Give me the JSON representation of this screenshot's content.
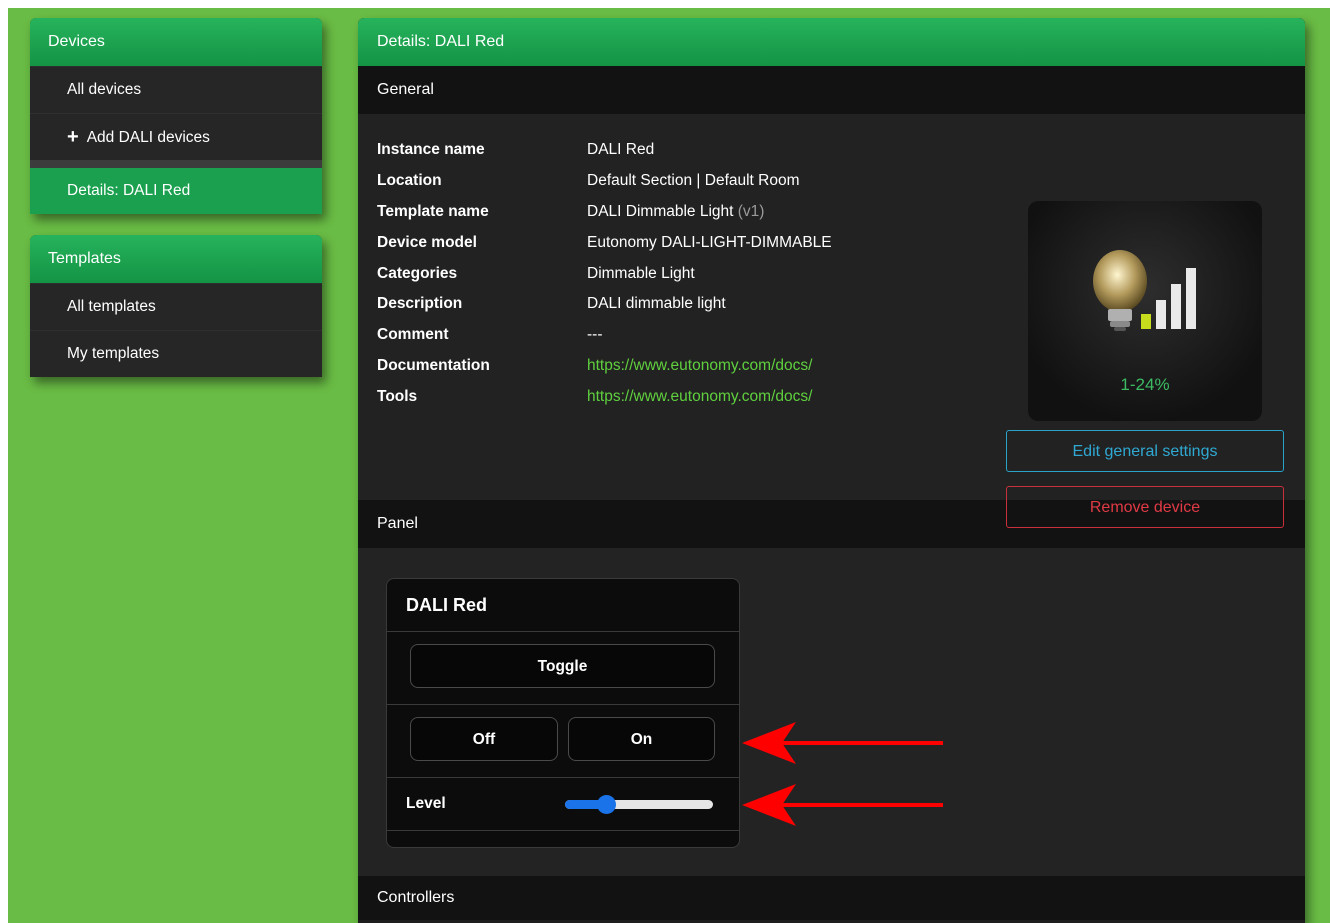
{
  "sidebar": {
    "devices": {
      "header": "Devices",
      "items": [
        {
          "label": "All devices"
        },
        {
          "label": "Add DALI devices"
        },
        {
          "label": "Details: DALI Red"
        }
      ]
    },
    "templates": {
      "header": "Templates",
      "items": [
        {
          "label": "All templates"
        },
        {
          "label": "My templates"
        }
      ]
    }
  },
  "main": {
    "header": "Details: DALI Red",
    "general": {
      "title": "General",
      "rows": [
        {
          "label": "Instance name",
          "value": "DALI Red"
        },
        {
          "label": "Location",
          "value": "Default Section | Default Room"
        },
        {
          "label": "Template name",
          "value": "DALI Dimmable Light",
          "version": "(v1)"
        },
        {
          "label": "Device model",
          "value": "Eutonomy DALI-LIGHT-DIMMABLE"
        },
        {
          "label": "Categories",
          "value": "Dimmable Light"
        },
        {
          "label": "Description",
          "value": "DALI dimmable light"
        },
        {
          "label": "Comment",
          "value": "---"
        },
        {
          "label": "Documentation",
          "value": "https://www.eutonomy.com/docs/"
        },
        {
          "label": "Tools",
          "value": "https://www.eutonomy.com/docs/"
        }
      ],
      "device_status": "1-24%",
      "device_icon": "lightbulb-signal-icon",
      "edit_button": "Edit general settings",
      "remove_button": "Remove device"
    },
    "panel": {
      "title": "Panel",
      "widget": {
        "title": "DALI Red",
        "toggle": "Toggle",
        "off": "Off",
        "on": "On",
        "level_label": "Level",
        "level_value": 0.28
      }
    },
    "controllers": {
      "title": "Controllers"
    }
  },
  "colors": {
    "background": "#69bc45",
    "header_green": "#1aa04f",
    "link_green": "#5fd03e",
    "edit_blue": "#2fa9d3",
    "remove_red": "#e03a45",
    "slider_blue": "#1a73e8",
    "annotation_red": "#ff0000"
  }
}
